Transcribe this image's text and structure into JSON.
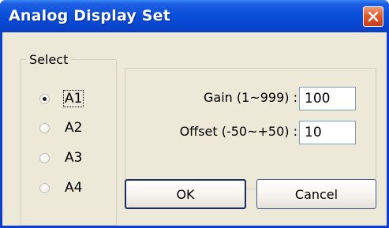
{
  "window": {
    "title": "Analog Display Set",
    "close_icon": "close-icon",
    "accent": "#0a3fd0",
    "close_color": "#e25a2d"
  },
  "select_group": {
    "label": "Select",
    "options": [
      {
        "label": "A1",
        "checked": true
      },
      {
        "label": "A2",
        "checked": false
      },
      {
        "label": "A3",
        "checked": false
      },
      {
        "label": "A4",
        "checked": false
      }
    ]
  },
  "settings": {
    "gain_label": "Gain (1~999) :",
    "gain_value": "100",
    "offset_label": "Offset (-50~+50) :",
    "offset_value": "10"
  },
  "buttons": {
    "ok_label": "OK",
    "cancel_label": "Cancel"
  }
}
